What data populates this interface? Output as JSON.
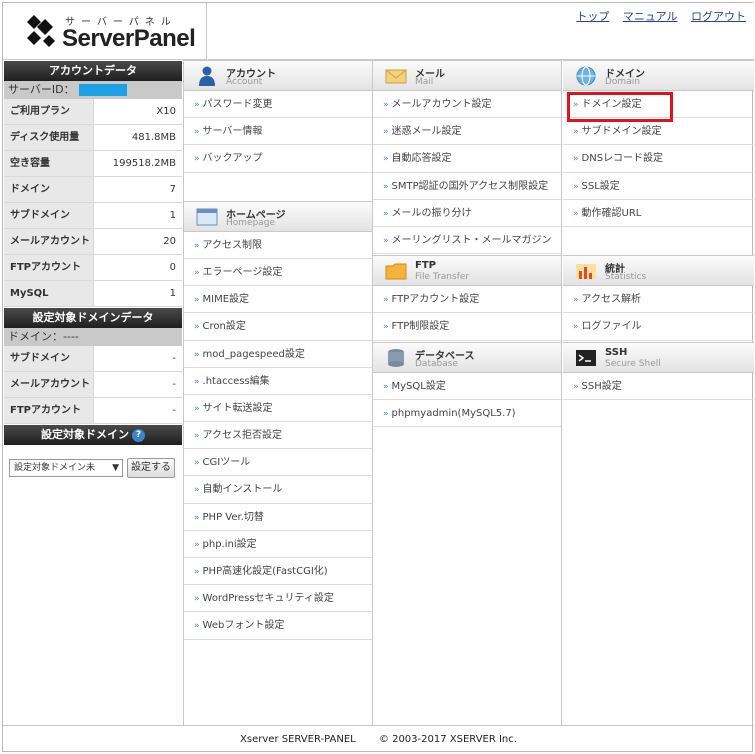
{
  "header": {
    "logo_kana": "サーバーパネル",
    "logo_text": "ServerPanel",
    "links": [
      "トップ",
      "マニュアル",
      "ログアウト"
    ]
  },
  "sidebar": {
    "account_title": "アカウントデータ",
    "server_id_label": "サーバーID：",
    "rows": [
      {
        "label": "ご利用プラン",
        "value": "X10"
      },
      {
        "label": "ディスク使用量",
        "value": "481.8MB"
      },
      {
        "label": "空き容量",
        "value": "199518.2MB"
      },
      {
        "label": "ドメイン",
        "value": "7"
      },
      {
        "label": "サブドメイン",
        "value": "1"
      },
      {
        "label": "メールアカウント",
        "value": "20"
      },
      {
        "label": "FTPアカウント",
        "value": "0"
      },
      {
        "label": "MySQL",
        "value": "1"
      }
    ],
    "target_title": "設定対象ドメインデータ",
    "domain_label": "ドメイン：----",
    "target_rows": [
      {
        "label": "サブドメイン",
        "value": "-"
      },
      {
        "label": "メールアカウント",
        "value": "-"
      },
      {
        "label": "FTPアカウント",
        "value": "-"
      }
    ],
    "select_title": "設定対象ドメイン",
    "help_icon": "?",
    "select_value": "設定対象ドメイン未",
    "set_button": "設定する"
  },
  "categories": {
    "account": {
      "jp": "アカウント",
      "en": "Account",
      "items": [
        "パスワード変更",
        "サーバー情報",
        "バックアップ"
      ]
    },
    "homepage": {
      "jp": "ホームページ",
      "en": "Homepage",
      "items": [
        "アクセス制限",
        "エラーページ設定",
        "MIME設定",
        "Cron設定",
        "mod_pagespeed設定",
        ".htaccess編集",
        "サイト転送設定",
        "アクセス拒否設定",
        "CGIツール",
        "自動インストール",
        "PHP Ver.切替",
        "php.ini設定",
        "PHP高速化設定(FastCGI化)",
        "WordPressセキュリティ設定",
        "Webフォント設定"
      ]
    },
    "mail": {
      "jp": "メール",
      "en": "Mail",
      "items": [
        "メールアカウント設定",
        "迷惑メール設定",
        "自動応答設定",
        "SMTP認証の国外アクセス制限設定",
        "メールの振り分け",
        "メーリングリスト・メールマガジン"
      ]
    },
    "ftp": {
      "jp": "FTP",
      "en": "File Transfer",
      "items": [
        "FTPアカウント設定",
        "FTP制限設定"
      ]
    },
    "database": {
      "jp": "データベース",
      "en": "Database",
      "items": [
        "MySQL設定",
        "phpmyadmin(MySQL5.7)"
      ]
    },
    "domain": {
      "jp": "ドメイン",
      "en": "Domain",
      "items": [
        "ドメイン設定",
        "サブドメイン設定",
        "DNSレコード設定",
        "SSL設定",
        "動作確認URL"
      ]
    },
    "stats": {
      "jp": "統計",
      "en": "Statistics",
      "items": [
        "アクセス解析",
        "ログファイル"
      ]
    },
    "ssh": {
      "jp": "SSH",
      "en": "Secure Shell",
      "items": [
        "SSH設定"
      ]
    }
  },
  "footer": {
    "product": "Xserver SERVER-PANEL",
    "copyright": "© 2003-2017 XSERVER Inc."
  },
  "colors": {
    "highlight": "#e0141e",
    "link": "#2a3f9e",
    "id_mask": "#1ea0e6"
  }
}
